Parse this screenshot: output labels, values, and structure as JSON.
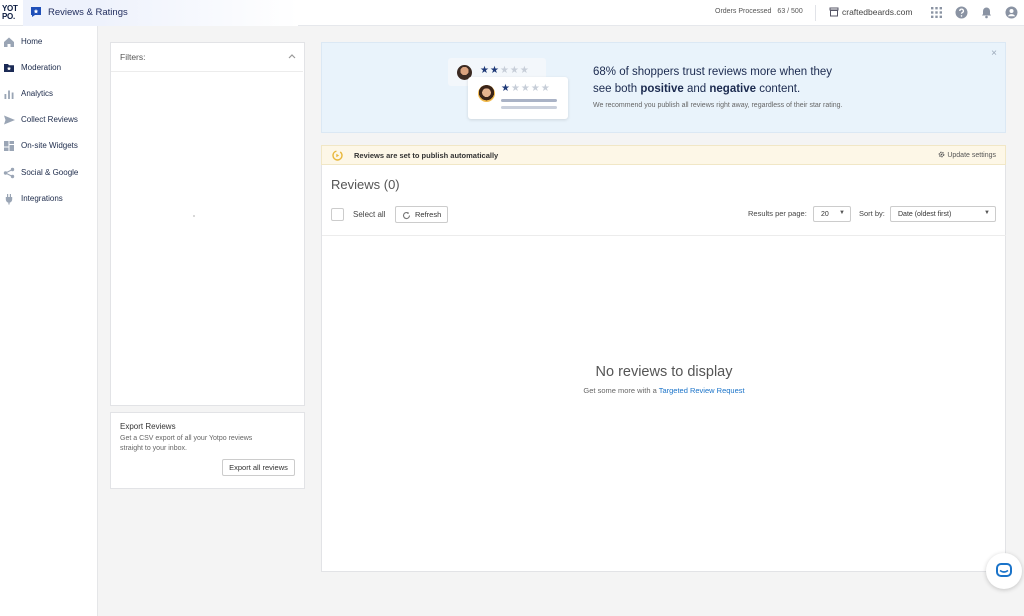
{
  "brand": {
    "logo_text_1": "YOT",
    "logo_text_2": "PO."
  },
  "header": {
    "app_title": "Reviews & Ratings",
    "orders_label": "Orders Processed",
    "orders_value": "63 / 500",
    "store_name": "craftedbeards.com"
  },
  "sidebar": {
    "items": [
      {
        "label": "Home",
        "icon": "home-icon"
      },
      {
        "label": "Moderation",
        "icon": "moderation-icon"
      },
      {
        "label": "Analytics",
        "icon": "analytics-icon"
      },
      {
        "label": "Collect Reviews",
        "icon": "send-icon"
      },
      {
        "label": "On-site Widgets",
        "icon": "widgets-icon"
      },
      {
        "label": "Social & Google",
        "icon": "share-icon"
      },
      {
        "label": "Integrations",
        "icon": "plug-icon"
      }
    ]
  },
  "filters": {
    "title": "Filters:"
  },
  "export": {
    "title": "Export Reviews",
    "description": "Get a CSV export of all your Yotpo reviews straight to your inbox.",
    "button": "Export all reviews"
  },
  "banner": {
    "line1": "68% of shoppers trust reviews more when they",
    "line2_pre": "see both ",
    "line2_bold1": "positive",
    "line2_mid": " and ",
    "line2_bold2": "negative",
    "line2_post": " content.",
    "small": "We recommend you publish all reviews right away, regardless of their star rating.",
    "close": "×",
    "back_card_rating": 2,
    "front_card_rating": 1
  },
  "notice": {
    "text": "Reviews are set to publish automatically",
    "update_link": "Update settings"
  },
  "reviews": {
    "title": "Reviews (0)",
    "select_all": "Select all",
    "refresh": "Refresh",
    "results_per_page_label": "Results per page:",
    "results_per_page_value": "20",
    "sort_label": "Sort by:",
    "sort_value": "Date (oldest first)",
    "empty_title": "No reviews to display",
    "empty_sub_pre": "Get some more with a ",
    "empty_sub_link": "Targeted Review Request"
  },
  "colors": {
    "accent": "#1a73c9",
    "navy": "#1f3a78",
    "banner_bg": "#e9f3fb",
    "notice_bg": "#fdf7e7"
  }
}
